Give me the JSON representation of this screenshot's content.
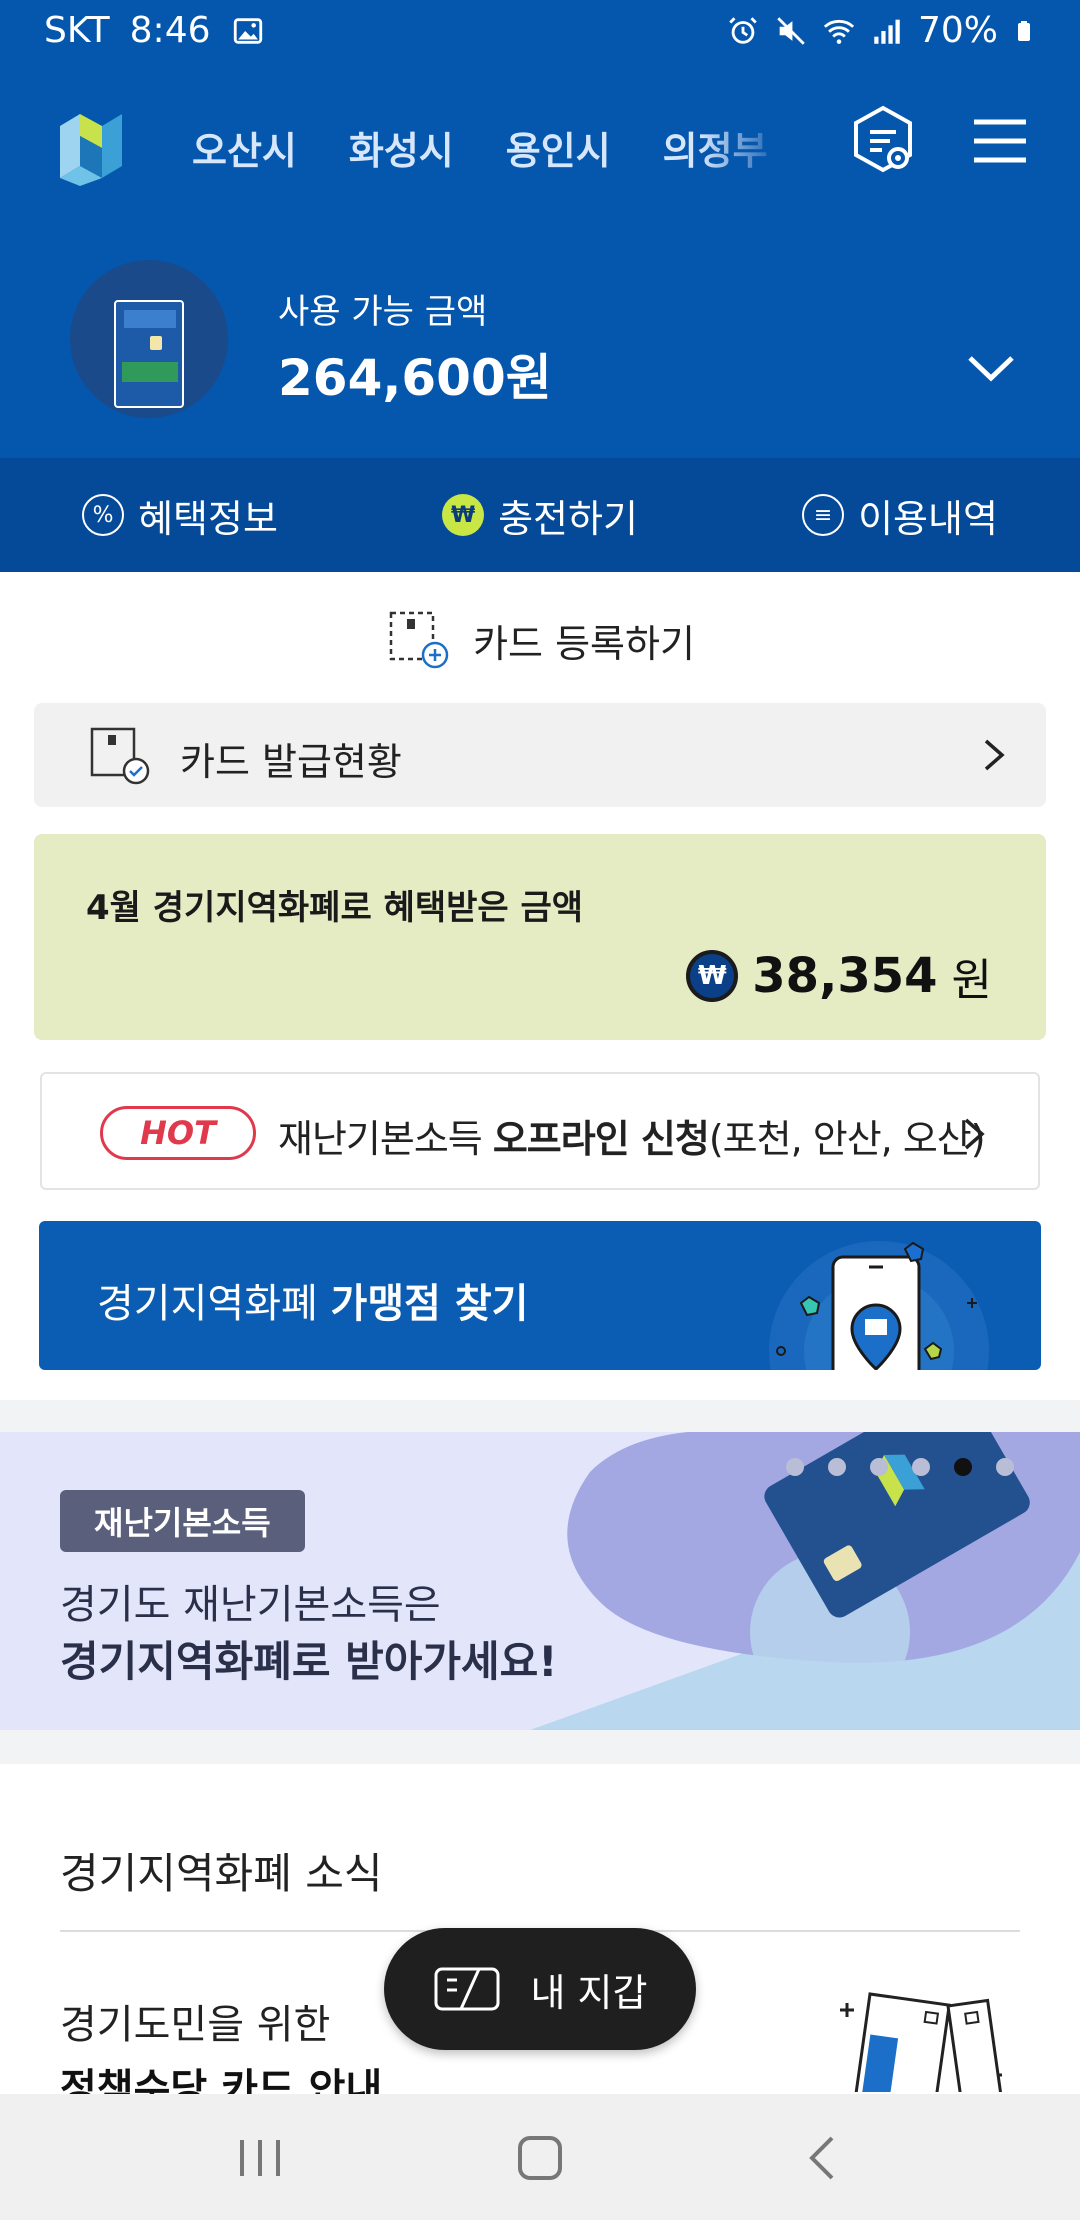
{
  "status_bar": {
    "carrier": "SKT",
    "time": "8:46",
    "battery": "70%"
  },
  "header": {
    "region_tabs": [
      "오산시",
      "화성시",
      "용인시",
      "의정부"
    ]
  },
  "balance": {
    "label": "사용 가능 금액",
    "amount": "264,600원"
  },
  "actions": [
    {
      "label": "혜택정보",
      "icon": "percent-icon"
    },
    {
      "label": "충전하기",
      "icon": "won-icon"
    },
    {
      "label": "이용내역",
      "icon": "receipt-icon"
    }
  ],
  "register": {
    "label": "카드 등록하기"
  },
  "issue": {
    "label": "카드 발급현황"
  },
  "benefit": {
    "title": "4월 경기지역화폐로 혜택받은 금액",
    "currency_symbol": "₩",
    "amount": "38,354",
    "unit": "원"
  },
  "hot": {
    "badge": "HOT",
    "text_prefix": "재난기본소득 ",
    "text_bold": "오프라인 신청",
    "text_suffix": "(포천, 안산, 오산)"
  },
  "store_banner": {
    "text_prefix": "경기지역화폐 ",
    "text_bold": "가맹점 찾기"
  },
  "promo": {
    "tag": "재난기본소득",
    "line1": "경기도 재난기본소득은",
    "line2": "경기지역화폐로 받아가세요!",
    "slide_count": 6,
    "active_slide": 5
  },
  "news": {
    "title": "경기지역화폐 소식",
    "item_line1": "경기도민을 위한",
    "item_line2": "정책수당 카드 안내"
  },
  "wallet": {
    "label": "내 지갑"
  },
  "colors": {
    "primary_blue": "#0556ad",
    "action_bar": "#044a98",
    "benefit_bg": "#e5ecc4",
    "hot_red": "#e0394c",
    "promo_bg": "#e3e6fb"
  }
}
